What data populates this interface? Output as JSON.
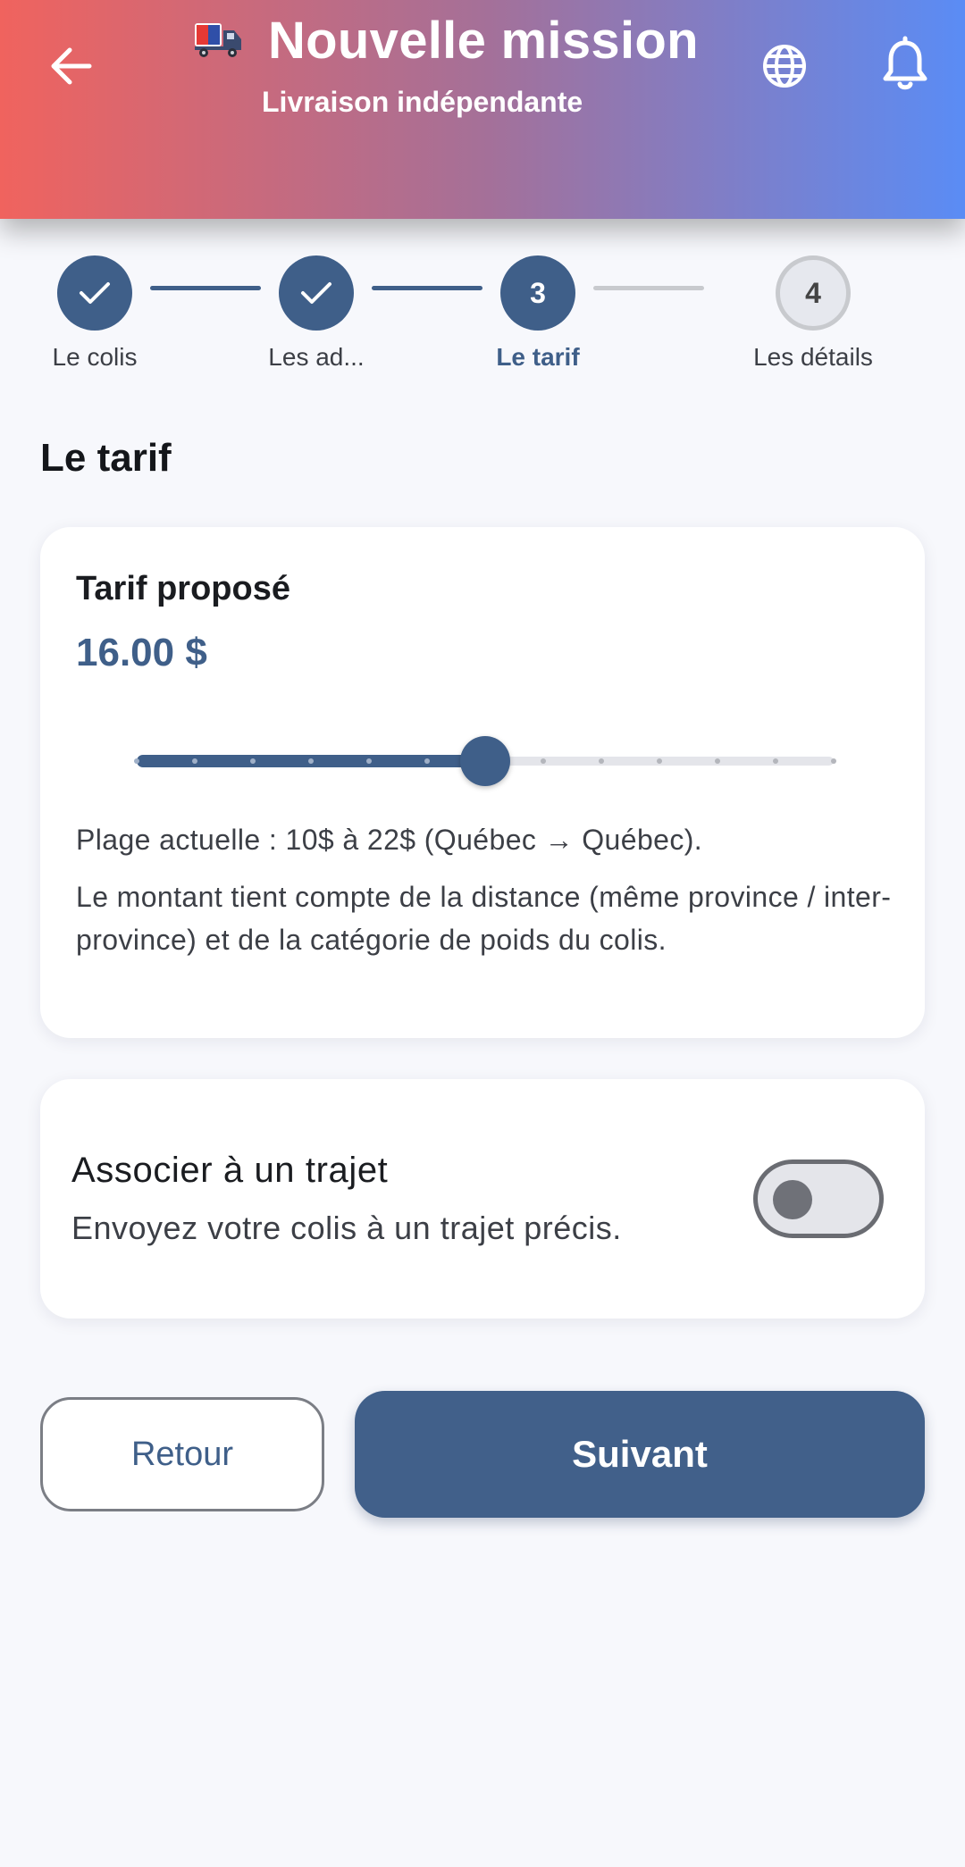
{
  "header": {
    "title": "Nouvelle mission",
    "subtitle": "Livraison indépendante",
    "icons": {
      "back": "arrow-left-icon",
      "logo": "delivery-truck-icon",
      "language": "globe-icon",
      "notifications": "bell-icon"
    }
  },
  "stepper": {
    "steps": [
      {
        "label": "Le colis",
        "state": "done",
        "marker": "✓"
      },
      {
        "label": "Les ad...",
        "state": "done",
        "marker": "✓"
      },
      {
        "label": "Le tarif",
        "state": "active",
        "marker": "3"
      },
      {
        "label": "Les détails",
        "state": "todo",
        "marker": "4"
      }
    ]
  },
  "section": {
    "title": "Le tarif"
  },
  "tarif": {
    "label": "Tarif proposé",
    "value_text": "16.00 $",
    "slider": {
      "min": 10,
      "max": 22,
      "value": 16,
      "step": 1
    },
    "range_text": "Plage actuelle : 10$ à 22$ (Québec → Québec).",
    "note": "Le montant tient compte de la distance (même province / inter-province) et de la catégorie de poids du colis."
  },
  "trajet": {
    "title": "Associer à un trajet",
    "subtitle": "Envoyez votre colis à un trajet précis.",
    "enabled": false
  },
  "actions": {
    "back_label": "Retour",
    "next_label": "Suivant"
  },
  "colors": {
    "primary": "#3f5f89",
    "gradient_start": "#f0635e",
    "gradient_end": "#5a8cf5",
    "background": "#f7f8fc"
  }
}
